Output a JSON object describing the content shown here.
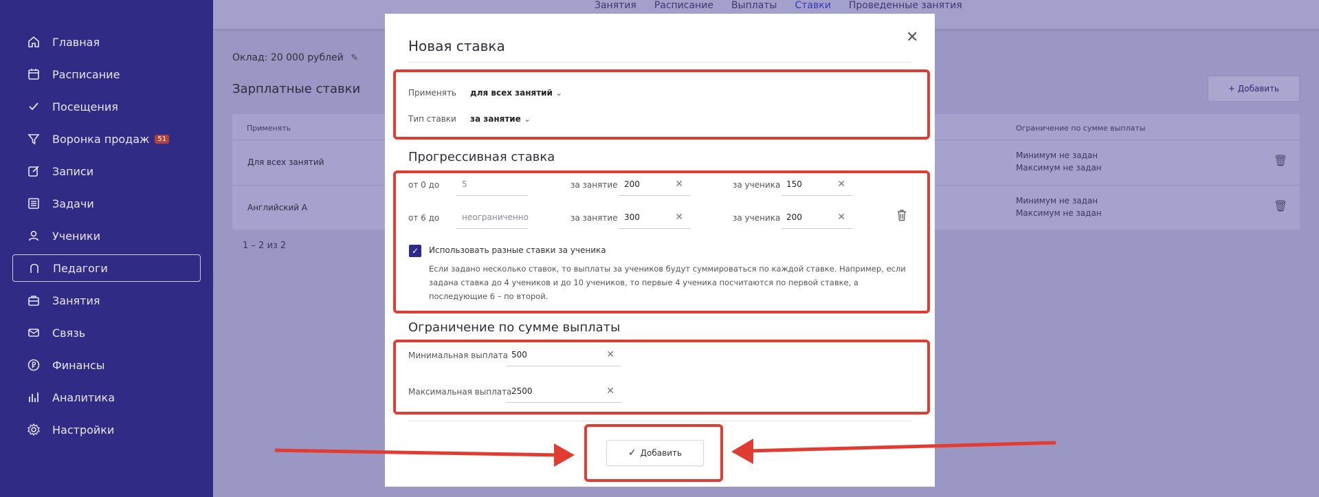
{
  "sidebar": {
    "items": [
      {
        "label": "Главная",
        "icon": "home-icon"
      },
      {
        "label": "Расписание",
        "icon": "calendar-icon"
      },
      {
        "label": "Посещения",
        "icon": "check-icon"
      },
      {
        "label": "Воронка продаж",
        "icon": "funnel-icon",
        "badge": "51"
      },
      {
        "label": "Записи",
        "icon": "edit-icon"
      },
      {
        "label": "Задачи",
        "icon": "tasks-icon"
      },
      {
        "label": "Ученики",
        "icon": "user-icon"
      },
      {
        "label": "Педагоги",
        "icon": "teacher-icon"
      },
      {
        "label": "Занятия",
        "icon": "briefcase-icon"
      },
      {
        "label": "Связь",
        "icon": "mail-icon"
      },
      {
        "label": "Финансы",
        "icon": "ruble-icon"
      },
      {
        "label": "Аналитика",
        "icon": "chart-icon"
      },
      {
        "label": "Настройки",
        "icon": "gear-icon"
      }
    ],
    "active": "Педагоги"
  },
  "tabs": [
    "Занятия",
    "Расписание",
    "Выплаты",
    "Ставки",
    "Проведенные занятия"
  ],
  "active_tab": "Ставки",
  "background": {
    "salary": "Оклад: 20 000 рублей",
    "section_title": "Зарплатные ставки",
    "add_button": "+ Добавить",
    "table_headers": {
      "apply": "Применять",
      "limit": "Ограничение по сумме выплаты"
    },
    "rows": [
      {
        "apply": "Для всех занятий",
        "min": "Минимум не задан",
        "max": "Максимум не задан"
      },
      {
        "apply": "Английский А",
        "min": "Минимум не задан",
        "max": "Максимум не задан"
      }
    ],
    "pager": "1 – 2 из 2"
  },
  "modal": {
    "title": "Новая ставка",
    "apply_label": "Применять",
    "apply_value": "для всех занятий",
    "type_label": "Тип ставки",
    "type_value": "за занятие",
    "progressive_title": "Прогрессивная ставка",
    "rates": [
      {
        "from": "от 0 до",
        "to": "5",
        "to_placeholder": false,
        "lesson_label": "за занятие",
        "lesson": "200",
        "student_label": "за ученика",
        "student": "150"
      },
      {
        "from": "от 6 до",
        "to": "неограниченно",
        "to_placeholder": true,
        "lesson_label": "за занятие",
        "lesson": "300",
        "student_label": "за ученика",
        "student": "200"
      }
    ],
    "checkbox_label": "Использовать разные ставки за ученика",
    "checkbox_desc": "Если задано несколько ставок, то выплаты за учеников будут суммироваться по каждой ставке. Например, если задана ставка до 4 учеников и до 10 учеников, то первые 4 ученика посчитаются по первой ставке, а последующие 6 – по второй.",
    "limit_title": "Ограничение по сумме выплаты",
    "min_label": "Минимальная выплата",
    "min_value": "500",
    "max_label": "Максимальная выплата",
    "max_value": "2500",
    "submit": "Добавить"
  },
  "colors": {
    "sidebar": "#302b84",
    "accent": "#2d2a8a",
    "annotation": "#e03c31"
  }
}
